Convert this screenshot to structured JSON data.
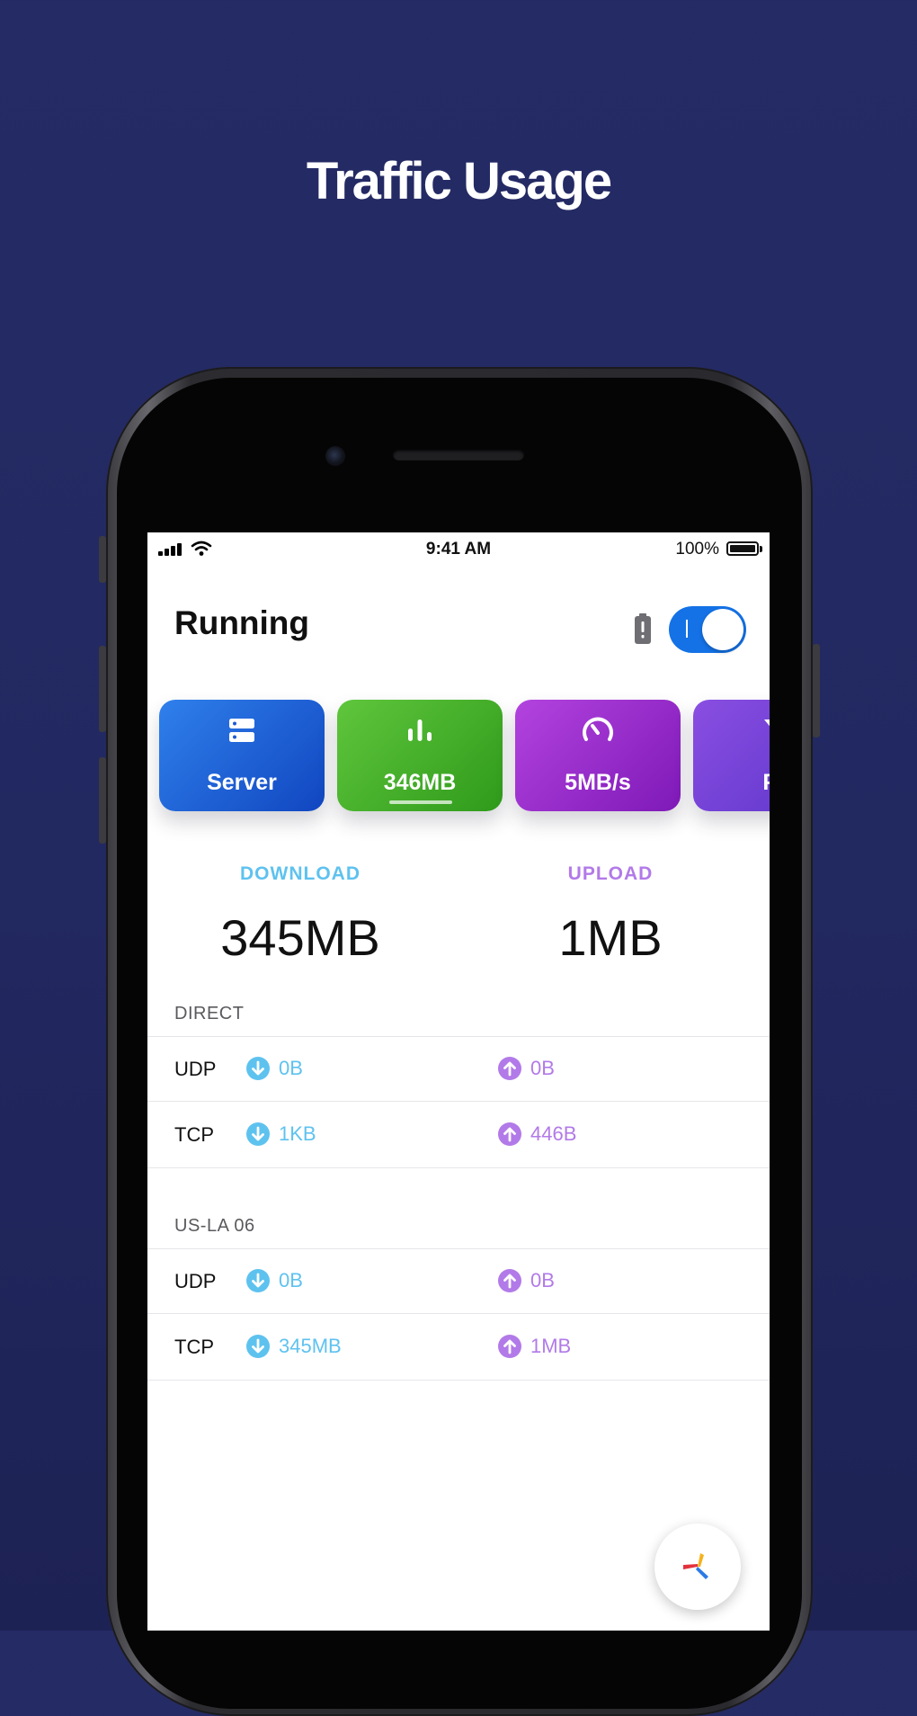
{
  "headline": "Traffic Usage",
  "status_bar": {
    "time": "9:41 AM",
    "battery_percent": "100%",
    "signal_icon": "cellular-signal-icon",
    "wifi_icon": "wifi-icon",
    "battery_icon": "battery-full-icon"
  },
  "header": {
    "title": "Running",
    "battery_alert_icon": "battery-alert-icon",
    "vpn_toggle_on": true
  },
  "cards": [
    {
      "label": "Server",
      "icon": "server-icon",
      "color": "#1f63dd"
    },
    {
      "label": "346MB",
      "icon": "bar-chart-icon",
      "color": "#46b12b",
      "active": true
    },
    {
      "label": "5MB/s",
      "icon": "speedometer-icon",
      "color": "#9a2bcc"
    },
    {
      "label": "Fil",
      "icon": "filter-icon",
      "color": "#7042d6"
    }
  ],
  "totals": {
    "download_label": "DOWNLOAD",
    "download_value": "345MB",
    "upload_label": "UPLOAD",
    "upload_value": "1MB"
  },
  "sections": [
    {
      "name": "DIRECT",
      "rows": [
        {
          "protocol": "UDP",
          "down": "0B",
          "up": "0B"
        },
        {
          "protocol": "TCP",
          "down": "1KB",
          "up": "446B"
        }
      ]
    },
    {
      "name": "US-LA 06",
      "rows": [
        {
          "protocol": "UDP",
          "down": "0B",
          "up": "0B"
        },
        {
          "protocol": "TCP",
          "down": "345MB",
          "up": "1MB"
        }
      ]
    }
  ],
  "fab_icon": "app-logo-icon",
  "colors": {
    "background": "#232a63",
    "download": "#5ec2ef",
    "upload": "#b27ae8",
    "toggle": "#1472e6"
  }
}
